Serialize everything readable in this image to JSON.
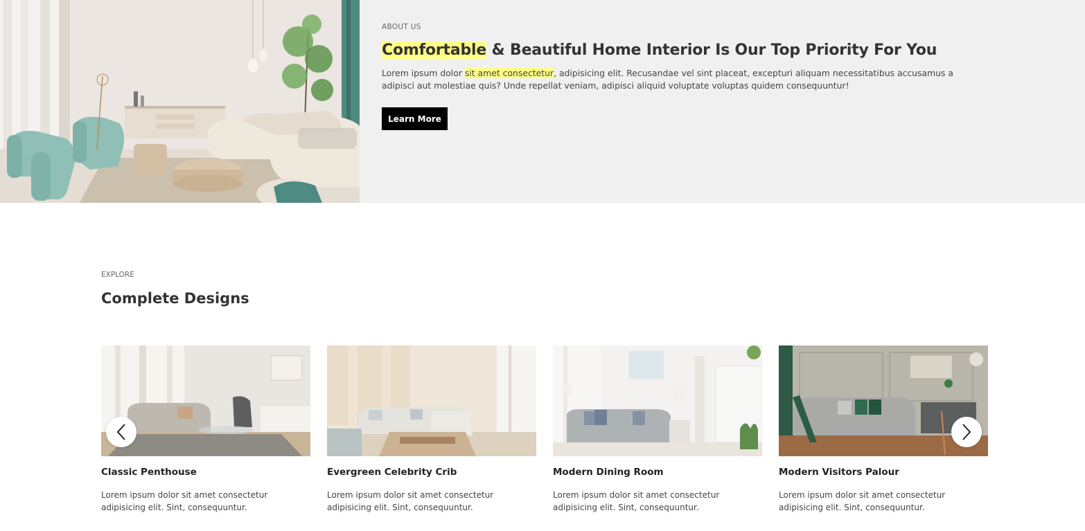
{
  "about": {
    "kicker": "ABOUT US",
    "title_highlight": "Comfortable",
    "title_rest": " & Beautiful Home Interior Is Our Top Priority For You",
    "desc_start": "Lorem ipsum dolor ",
    "desc_highlight": "sit amet consectetur",
    "desc_end": ", adipisicing elit. Recusandae vel sint placeat, excepturi aliquam necessitatibus accusamus a adipisci aut molestiae quis? Unde repellat veniam, adipisci aliquid voluptate voluptas quidem consequuntur!",
    "button_label": "Learn More",
    "highlight_color": "#ffff85"
  },
  "explore": {
    "kicker": "EXPLORE",
    "title": "Complete Designs",
    "cards": [
      {
        "title": "Classic Penthouse",
        "desc": "Lorem ipsum dolor sit amet consectetur adipisicing elit. Sint, consequuntur."
      },
      {
        "title": "Evergreen Celebrity Crib",
        "desc": "Lorem ipsum dolor sit amet consectetur adipisicing elit. Sint, consequuntur."
      },
      {
        "title": "Modern Dining Room",
        "desc": "Lorem ipsum dolor sit amet consectetur adipisicing elit. Sint, consequuntur."
      },
      {
        "title": "Modern Visitors Palour",
        "desc": "Lorem ipsum dolor sit amet consectetur adipisicing elit. Sint, consequuntur."
      }
    ],
    "prev_icon": "chevron-left-icon",
    "next_icon": "chevron-right-icon"
  }
}
